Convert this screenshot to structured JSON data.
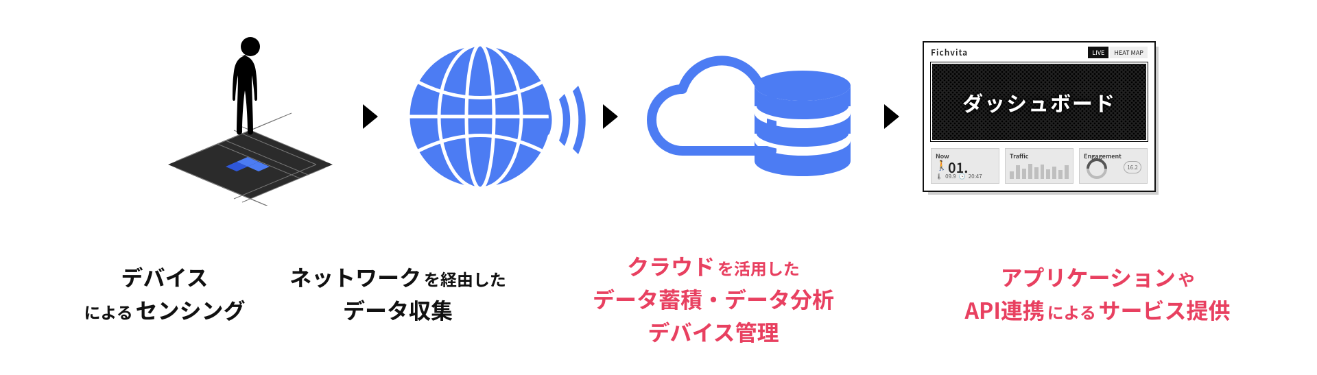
{
  "diagram": {
    "arrows": 3,
    "stage1": {
      "icon_name": "person-on-sensor-grid",
      "label_strong1": "デバイス",
      "label_by": "による",
      "label_strong2": "センシング",
      "color": "black"
    },
    "stage2": {
      "icon_name": "globe-with-signal",
      "label_strong": "ネットワーク",
      "label_mid": "を経由した",
      "label_line2": "データ収集",
      "color": "black"
    },
    "stage3": {
      "icon_name": "cloud-database",
      "label_strong": "クラウド",
      "label_mid": "を活用した",
      "label_line2": "データ蓄積・データ分析",
      "label_line3": "デバイス管理",
      "color": "red"
    },
    "stage4": {
      "icon_name": "dashboard-mock",
      "dashboard": {
        "brand": "Fichvita",
        "tab_live": "LIVE",
        "tab_heatmap": "HEAT MAP",
        "hero_title": "ダッシュボード",
        "card_now_title": "Now",
        "card_now_count": "01.",
        "card_now_sub1": "09.9",
        "card_now_sub2": "20:47",
        "card_traffic_title": "Traffic",
        "card_engagement_title": "Engagement",
        "card_engagement_badge": "16.2"
      },
      "label_strong1": "アプリケーション",
      "label_mid1": "や",
      "label_strong2": "API連携",
      "label_mid2": "による",
      "label_strong3": "サービス提供",
      "color": "red"
    }
  }
}
